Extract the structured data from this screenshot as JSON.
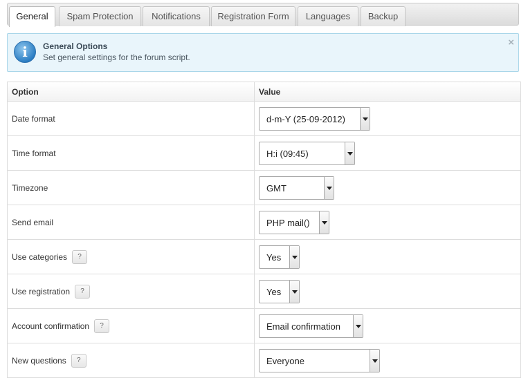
{
  "tabs": [
    {
      "label": "General",
      "active": true
    },
    {
      "label": "Spam Protection",
      "active": false
    },
    {
      "label": "Notifications",
      "active": false
    },
    {
      "label": "Registration Form",
      "active": false
    },
    {
      "label": "Languages",
      "active": false
    },
    {
      "label": "Backup",
      "active": false
    }
  ],
  "info": {
    "icon": "info-icon",
    "title": "General Options",
    "description": "Set general settings for the forum script.",
    "close": "×"
  },
  "table": {
    "headers": {
      "option": "Option",
      "value": "Value"
    },
    "rows": [
      {
        "label": "Date format",
        "value": "d-m-Y (25-09-2012)",
        "help": ""
      },
      {
        "label": "Time format",
        "value": "H:i (09:45)",
        "help": ""
      },
      {
        "label": "Timezone",
        "value": "GMT",
        "help": ""
      },
      {
        "label": "Send email",
        "value": "PHP mail()",
        "help": ""
      },
      {
        "label": "Use categories",
        "value": "Yes",
        "help": "?"
      },
      {
        "label": "Use registration",
        "value": "Yes",
        "help": "?"
      },
      {
        "label": "Account confirmation",
        "value": "Email confirmation",
        "help": "?"
      },
      {
        "label": "New questions",
        "value": "Everyone",
        "help": "?"
      }
    ]
  }
}
